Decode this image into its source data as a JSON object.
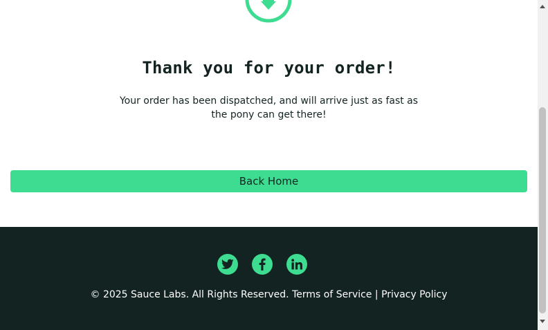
{
  "complete": {
    "title": "Thank you for your order!",
    "message": "Your order has been dispatched, and will arrive just as fast as the pony can get there!",
    "back_home_label": "Back Home",
    "check_icon": "pony-express-check-icon"
  },
  "footer": {
    "social": [
      {
        "name": "twitter",
        "icon": "twitter-icon"
      },
      {
        "name": "facebook",
        "icon": "facebook-icon"
      },
      {
        "name": "linkedin",
        "icon": "linkedin-icon"
      }
    ],
    "copy": "© 2025 Sauce Labs. All Rights Reserved.",
    "terms": "Terms of Service",
    "separator": "|",
    "privacy": "Privacy Policy"
  },
  "colors": {
    "accent": "#3ddc91",
    "footer_bg": "#132322",
    "text_dark": "#132322",
    "text_light": "#ffffff"
  }
}
